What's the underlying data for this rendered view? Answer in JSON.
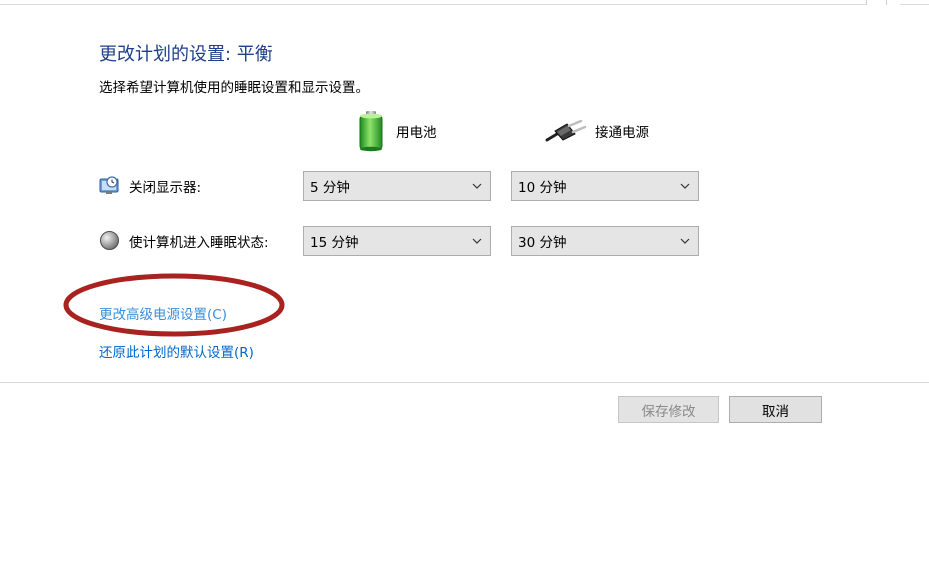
{
  "header": {
    "title": "更改计划的设置: 平衡",
    "subtitle": "选择希望计算机使用的睡眠设置和显示设置。"
  },
  "columns": {
    "battery": {
      "label": "用电池",
      "icon": "battery-icon"
    },
    "plugged": {
      "label": "接通电源",
      "icon": "power-plug-icon"
    }
  },
  "rows": [
    {
      "label": "关闭显示器:",
      "icon": "monitor-clock-icon",
      "battery_value": "5 分钟",
      "plugged_value": "10 分钟"
    },
    {
      "label": "使计算机进入睡眠状态:",
      "icon": "moon-sleep-icon",
      "battery_value": "15 分钟",
      "plugged_value": "30 分钟"
    }
  ],
  "links": {
    "advanced": "更改高级电源设置(C)",
    "restore": "还原此计划的默认设置(R)"
  },
  "buttons": {
    "save": "保存修改",
    "cancel": "取消"
  },
  "colors": {
    "title": "#1e3f8b",
    "link": "#0066cc",
    "highlight_ellipse": "#a8231f"
  }
}
